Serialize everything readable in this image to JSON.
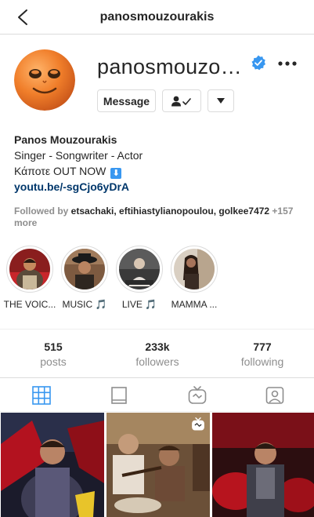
{
  "header": {
    "title": "panosmouzourakis",
    "back_icon": "chevron-left-icon"
  },
  "profile": {
    "username": "panosmouzourakis",
    "verified": true,
    "accent_color": "#3897f0",
    "buttons": {
      "message": "Message",
      "follow_icon": "person-check-icon",
      "dropdown_icon": "caret-down-icon"
    },
    "more_icon": "ellipsis-icon"
  },
  "bio": {
    "name": "Panos Mouzourakis",
    "line1": "Singer - Songwriter - Actor",
    "line2": "Κάποτε OUT NOW",
    "line2_icon": "⬇",
    "link": "youtu.be/-sgCjo6yDrA"
  },
  "followed_by": {
    "prefix": "Followed by ",
    "names": "etsachaki, eftihiastylianopoulou, golkee7472",
    "suffix": " +157 more"
  },
  "highlights": [
    {
      "label": "THE VOIC..."
    },
    {
      "label": "MUSIC 🎵"
    },
    {
      "label": "LIVE 🎵"
    },
    {
      "label": "MAMMA ..."
    }
  ],
  "stats": [
    {
      "value": "515",
      "label": "posts"
    },
    {
      "value": "233k",
      "label": "followers"
    },
    {
      "value": "777",
      "label": "following"
    }
  ],
  "tabs": [
    {
      "name": "grid",
      "active": true
    },
    {
      "name": "feed",
      "active": false
    },
    {
      "name": "igtv",
      "active": false
    },
    {
      "name": "tagged",
      "active": false
    }
  ],
  "posts": [
    {
      "type": "image"
    },
    {
      "type": "igtv"
    },
    {
      "type": "image"
    }
  ]
}
